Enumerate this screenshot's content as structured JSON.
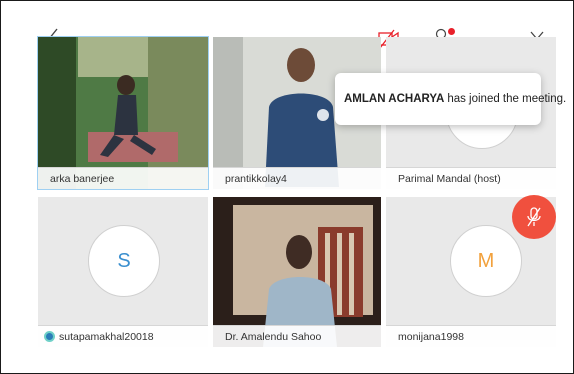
{
  "toolbar": {
    "back_icon": "chevron-left-icon",
    "camera_icon": "camera-off-icon",
    "participants_icon": "participants-icon",
    "more_label": "···",
    "close_icon": "close-icon",
    "camera_off_color": "#e8202a",
    "badge_color": "#e8202a"
  },
  "notification": {
    "name": "AMLAN ACHARYA",
    "message": "has joined the meeting."
  },
  "participants": [
    {
      "name": "arka banerjee",
      "video": true
    },
    {
      "name": "prantikkolay4",
      "video": true
    },
    {
      "name": "Parimal Mandal (host)",
      "video": false
    },
    {
      "name": "sutapamakhal20018",
      "video": false,
      "avatar_letter": "S",
      "avatar_color": "#3a8fcf",
      "status_icon": "connection-icon"
    },
    {
      "name": "Dr. Amalendu Sahoo",
      "video": true
    },
    {
      "name": "monijana1998",
      "video": false,
      "avatar_letter": "M",
      "avatar_color": "#f2a13c"
    }
  ],
  "mic_button": {
    "icon": "mic-muted-icon",
    "color": "#f0503e"
  }
}
